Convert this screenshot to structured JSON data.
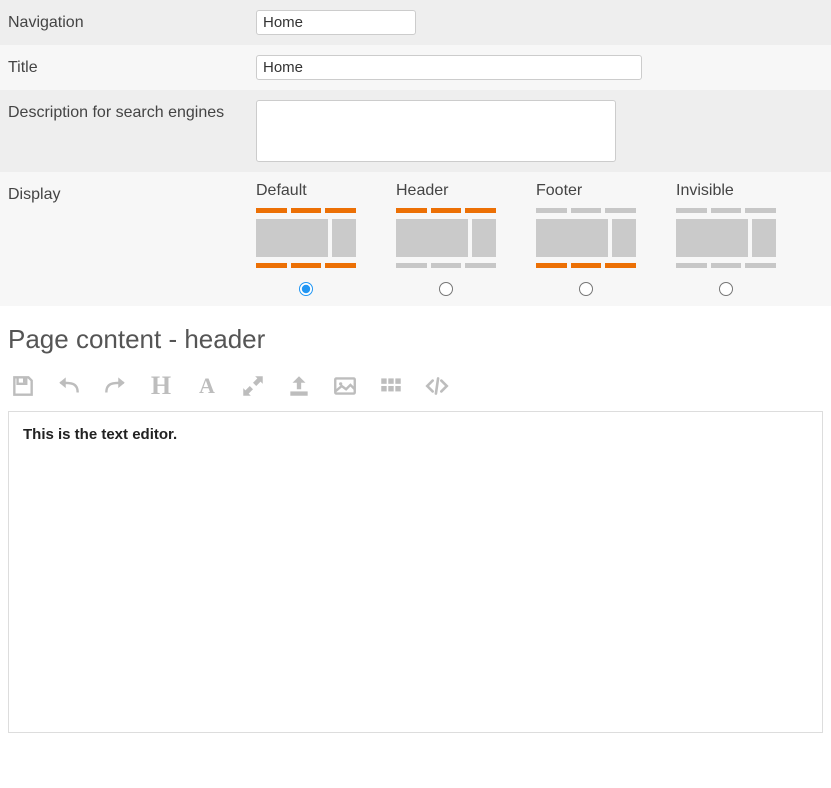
{
  "form": {
    "navigation": {
      "label": "Navigation",
      "value": "Home"
    },
    "title": {
      "label": "Title",
      "value": "Home"
    },
    "description": {
      "label": "Description for search engines",
      "value": ""
    },
    "display": {
      "label": "Display",
      "selected": "default",
      "options": [
        {
          "id": "default",
          "label": "Default",
          "top": "orange",
          "bottom": "orange"
        },
        {
          "id": "header",
          "label": "Header",
          "top": "orange",
          "bottom": "grey"
        },
        {
          "id": "footer",
          "label": "Footer",
          "top": "grey",
          "bottom": "orange"
        },
        {
          "id": "invisible",
          "label": "Invisible",
          "top": "grey",
          "bottom": "grey"
        }
      ]
    }
  },
  "section_heading": "Page content - header",
  "toolbar": {
    "save": "save-icon",
    "undo": "undo-icon",
    "redo": "redo-icon",
    "heading": "H",
    "font": "A",
    "expand": "expand-icon",
    "upload": "upload-icon",
    "image": "image-icon",
    "grid": "grid-icon",
    "code": "code-icon"
  },
  "editor": {
    "content": "This is the text editor."
  }
}
